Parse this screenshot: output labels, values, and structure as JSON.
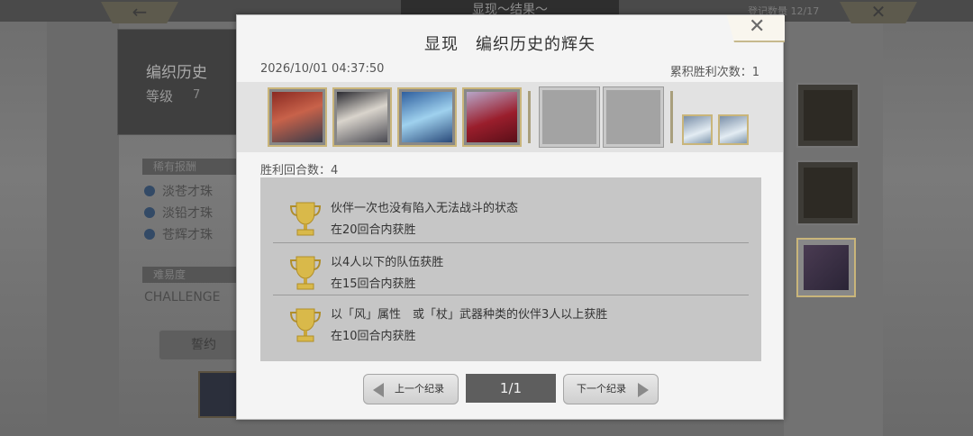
{
  "background": {
    "title": "显现～结果～",
    "record_count": "登记数量 12/17",
    "left_title": "编织历史",
    "level_label": "等级",
    "level_value": "7",
    "reward_header": "稀有报酬",
    "rewards": [
      "淡苍才珠",
      "淡铅才珠",
      "苍辉才珠"
    ],
    "difficulty_header": "难易度",
    "difficulty_value": "CHALLENGE",
    "pact_button": "誓约"
  },
  "modal": {
    "title": "显现　编织历史的辉矢",
    "close_icon": "close-icon",
    "datetime": "2026/10/01 04:37:50",
    "total_wins_label": "累积胜利次数：1",
    "party": {
      "members": [
        {
          "name": "portrait-red-hair-warrior"
        },
        {
          "name": "portrait-dark-hair-nun"
        },
        {
          "name": "portrait-blue-hair-mage"
        },
        {
          "name": "portrait-silver-hair-girl"
        }
      ],
      "empty_slots": 2,
      "sub_members": [
        {
          "name": "sub-unicorn-icon"
        },
        {
          "name": "sub-dolphin-icon"
        }
      ]
    },
    "win_rounds_label": "胜利回合数：4",
    "missions": [
      {
        "title": "伙伴一次也没有陷入无法战斗的状态",
        "sub": "在20回合内获胜",
        "icon": "trophy-icon"
      },
      {
        "title": "以4人以下的队伍获胜",
        "sub": "在15回合内获胜",
        "icon": "trophy-icon"
      },
      {
        "title": "以「风」属性　或「杖」武器种类的伙伴3人以上获胜",
        "sub": "在10回合内获胜",
        "icon": "trophy-icon"
      }
    ],
    "nav": {
      "prev_label": "上一个纪录",
      "page": "1/1",
      "next_label": "下一个纪录"
    }
  },
  "colors": {
    "trophy": "#d9b94a",
    "frame_gold": "#c9b57a",
    "page_indicator_bg": "#5e5e5e"
  }
}
